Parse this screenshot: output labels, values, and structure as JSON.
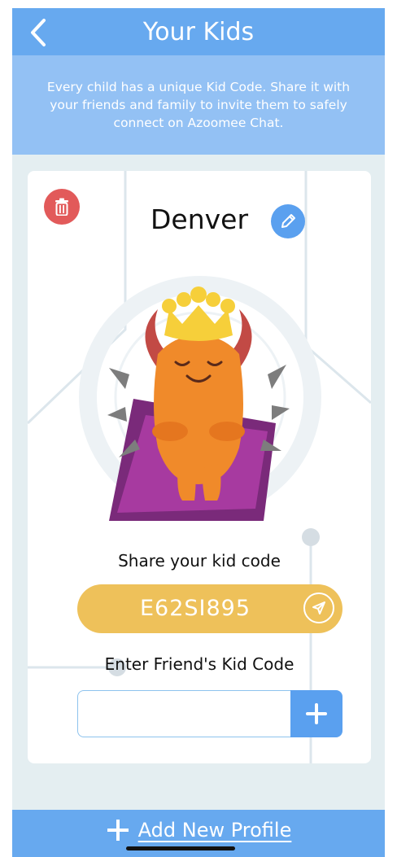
{
  "header": {
    "title": "Your Kids"
  },
  "banner": {
    "text": "Every child has a unique Kid Code. Share it with your friends and family to invite them to safely connect on Azoomee Chat."
  },
  "kid": {
    "name": "Denver",
    "avatar": "orange-monster-with-crown",
    "share_label": "Share your kid code",
    "code": "E62SI895",
    "friend_label": "Enter Friend's Kid Code",
    "friend_input_value": "",
    "friend_input_placeholder": ""
  },
  "footer": {
    "add_label": "Add New Profile"
  },
  "colors": {
    "header": "#67a9ef",
    "banner": "#93c1f4",
    "code_pill": "#eec15a",
    "delete": "#e25a5a",
    "accent": "#5aa0ef"
  }
}
